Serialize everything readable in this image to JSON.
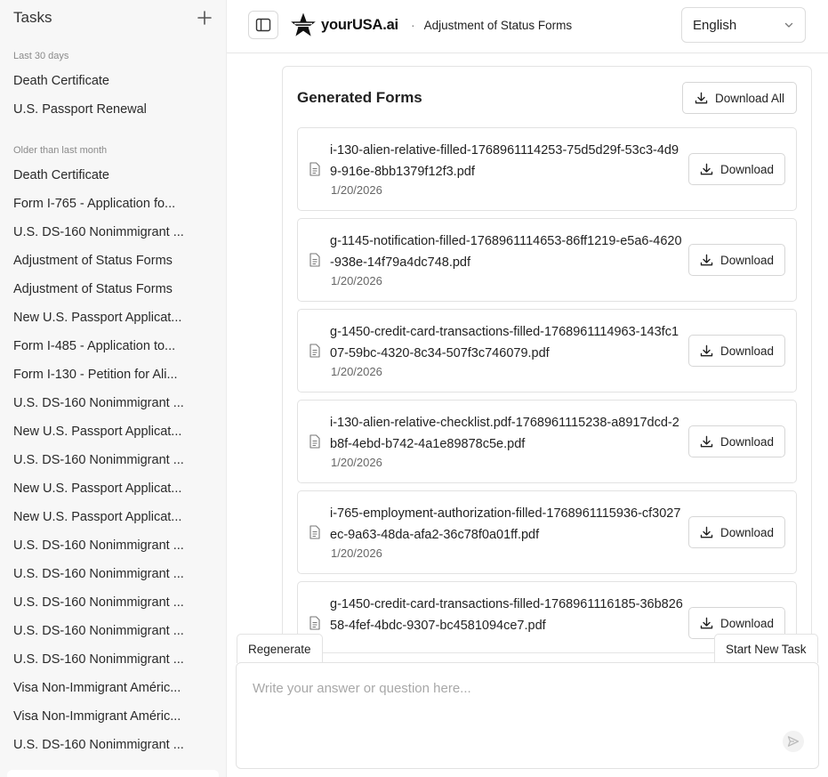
{
  "sidebar": {
    "title": "Tasks",
    "new_task_icon": "plus-icon",
    "recent_label": "Last 30 days",
    "recent_items": [
      "Death Certificate",
      "U.S. Passport Renewal"
    ],
    "older_label": "Older than last month",
    "older_items": [
      "Death Certificate",
      "Form I-765 - Application fo...",
      "U.S. DS-160 Nonimmigrant ...",
      "Adjustment of Status Forms",
      "Adjustment of Status Forms",
      "New U.S. Passport Applicat...",
      "Form I-485 - Application to...",
      "Form I-130 - Petition for Ali...",
      "U.S. DS-160 Nonimmigrant ...",
      "New U.S. Passport Applicat...",
      "U.S. DS-160 Nonimmigrant ...",
      "New U.S. Passport Applicat...",
      "New U.S. Passport Applicat...",
      "U.S. DS-160 Nonimmigrant ...",
      "U.S. DS-160 Nonimmigrant ...",
      "U.S. DS-160 Nonimmigrant ...",
      "U.S. DS-160 Nonimmigrant ...",
      "U.S. DS-160 Nonimmigrant ...",
      "Visa Non-Immigrant Améric...",
      "Visa Non-Immigrant Améric...",
      "U.S. DS-160 Nonimmigrant ..."
    ]
  },
  "topbar": {
    "toggle_icon": "sidebar-toggle-icon",
    "brand_name": "yourUSA.ai",
    "separator": "·",
    "page_title": "Adjustment of Status Forms",
    "language": "English"
  },
  "forms": {
    "title": "Generated Forms",
    "download_all_label": "Download All",
    "download_label": "Download",
    "files": [
      {
        "name": "i-130-alien-relative-filled-1768961114253-75d5d29f-53c3-4d99-916e-8bb1379f12f3.pdf",
        "date": "1/20/2026"
      },
      {
        "name": "g-1145-notification-filled-1768961114653-86ff1219-e5a6-4620-938e-14f79a4dc748.pdf",
        "date": "1/20/2026"
      },
      {
        "name": "g-1450-credit-card-transactions-filled-1768961114963-143fc107-59bc-4320-8c34-507f3c746079.pdf",
        "date": "1/20/2026"
      },
      {
        "name": "i-130-alien-relative-checklist.pdf-1768961115238-a8917dcd-2b8f-4ebd-b742-4a1e89878c5e.pdf",
        "date": "1/20/2026"
      },
      {
        "name": "i-765-employment-authorization-filled-1768961115936-cf3027ec-9a63-48da-afa2-36c78f0a01ff.pdf",
        "date": "1/20/2026"
      },
      {
        "name": "g-1450-credit-card-transactions-filled-1768961116185-36b82658-4fef-4bdc-9307-bc4581094ce7.pdf",
        "date": ""
      }
    ]
  },
  "composer": {
    "regenerate_label": "Regenerate",
    "new_task_label": "Start New Task",
    "placeholder": "Write your answer or question here..."
  }
}
